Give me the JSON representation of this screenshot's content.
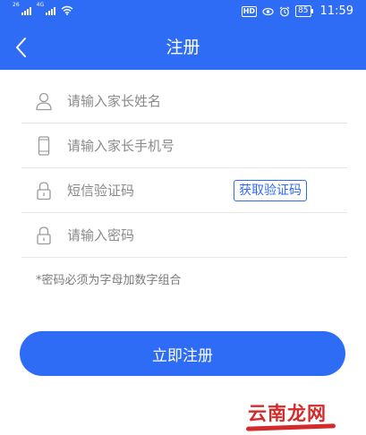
{
  "status_bar": {
    "signal_1": "26",
    "signal_2": "4G",
    "hd": "HD",
    "battery": "85",
    "time": "11:59"
  },
  "header": {
    "title": "注册"
  },
  "form": {
    "name_placeholder": "请输入家长姓名",
    "phone_placeholder": "请输入家长手机号",
    "sms_placeholder": "短信验证码",
    "get_code_label": "获取验证码",
    "password_placeholder": "请输入密码"
  },
  "hint": "*密码必须为字母加数字组合",
  "submit_label": "立即注册",
  "watermark": "云南龙网",
  "colors": {
    "primary": "#2f6cf6",
    "watermark": "#d42a2a"
  }
}
